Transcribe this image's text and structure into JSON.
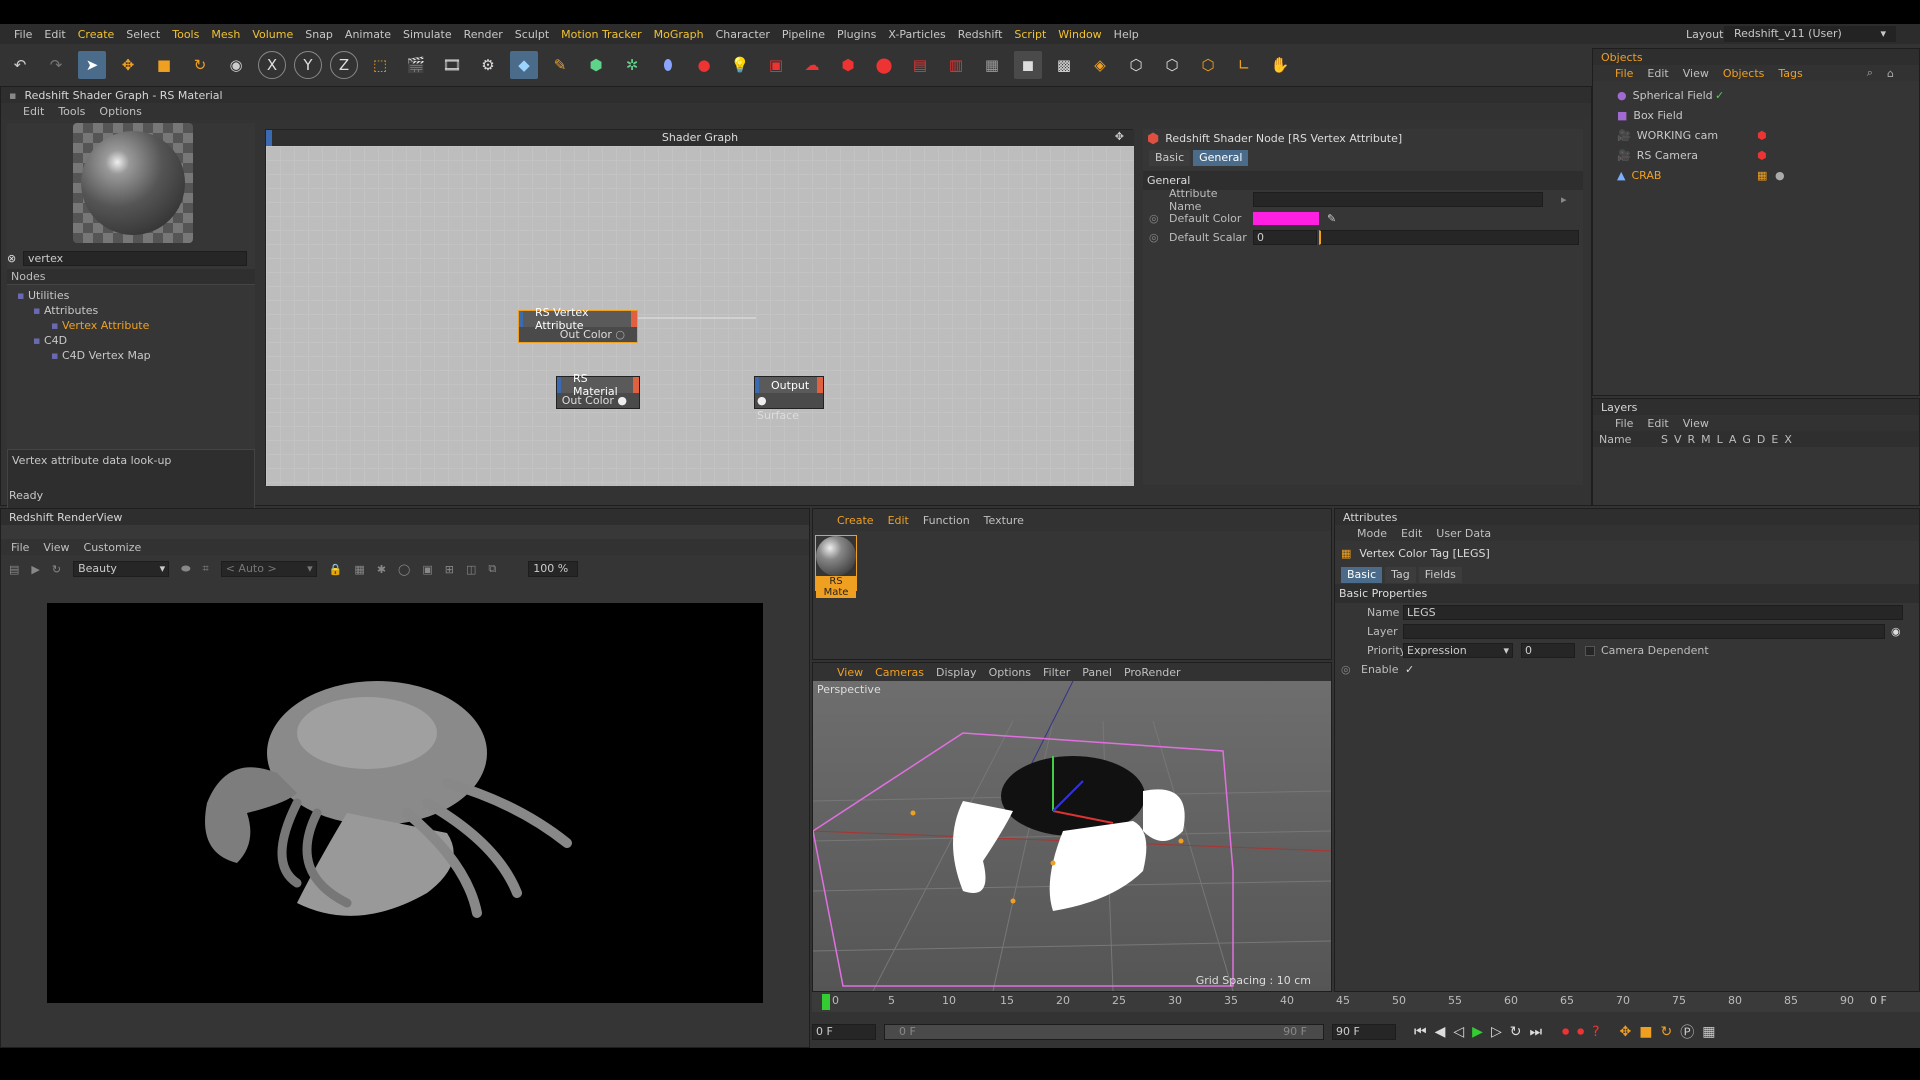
{
  "menubar": {
    "items": [
      "File",
      "Edit",
      "Create",
      "Select",
      "Tools",
      "Mesh",
      "Volume",
      "Snap",
      "Animate",
      "Simulate",
      "Render",
      "Sculpt",
      "Motion Tracker",
      "MoGraph",
      "Character",
      "Pipeline",
      "Plugins",
      "X-Particles",
      "Redshift",
      "Script",
      "Window",
      "Help"
    ],
    "layout_label": "Layout:",
    "layout_value": "Redshift_v11 (User)"
  },
  "shader_window": {
    "title": "Redshift Shader Graph - RS Material",
    "menu": [
      "Edit",
      "Tools",
      "Options"
    ],
    "search_value": "vertex",
    "nodes_header": "Nodes",
    "tree": [
      "Utilities",
      "Attributes",
      "Vertex Attribute",
      "C4D",
      "C4D Vertex Map"
    ],
    "description": "Vertex attribute data look-up",
    "graph_title": "Shader Graph",
    "nodes": {
      "vertex_attr": {
        "title": "RS Vertex Attribute",
        "port": "Out Color"
      },
      "material": {
        "title": "RS Material",
        "port": "Out Color"
      },
      "output": {
        "title": "Output",
        "port": "Surface"
      }
    },
    "props": {
      "title": "Redshift Shader Node [RS Vertex Attribute]",
      "tabs": [
        "Basic",
        "General"
      ],
      "section": "General",
      "attribute_name_label": "Attribute Name",
      "default_color_label": "Default Color",
      "default_color": "#ff1fe0",
      "default_scalar_label": "Default Scalar",
      "default_scalar_value": "0"
    },
    "status": "Ready"
  },
  "objects": {
    "title": "Objects",
    "menu": [
      "File",
      "Edit",
      "View",
      "Objects",
      "Tags"
    ],
    "items": [
      "Spherical Field",
      "Box Field",
      "WORKING cam",
      "RS Camera",
      "CRAB"
    ]
  },
  "layers": {
    "title": "Layers",
    "menu": [
      "File",
      "Edit",
      "View"
    ],
    "col_name": "Name",
    "cols": [
      "S",
      "V",
      "R",
      "M",
      "L",
      "A",
      "G",
      "D",
      "E",
      "X"
    ]
  },
  "renderview": {
    "title": "Redshift RenderView",
    "menu": [
      "File",
      "View",
      "Customize"
    ],
    "aov": "Beauty",
    "camera": "< Auto >",
    "zoom": "100 %"
  },
  "material_manager": {
    "menu": [
      "Create",
      "Edit",
      "Function",
      "Texture"
    ],
    "material_label": "RS Mate"
  },
  "viewport": {
    "menu": [
      "View",
      "Cameras",
      "Display",
      "Options",
      "Filter",
      "Panel",
      "ProRender"
    ],
    "camera_label": "Perspective",
    "grid_spacing": "Grid Spacing : 10 cm"
  },
  "timeline": {
    "ticks": [
      "0",
      "5",
      "10",
      "15",
      "20",
      "25",
      "30",
      "35",
      "40",
      "45",
      "50",
      "55",
      "60",
      "65",
      "70",
      "75",
      "80",
      "85",
      "90"
    ],
    "current_frame": "0 F",
    "start_field": "0 F",
    "range_start": "0 F",
    "range_end": "90 F",
    "end_field": "90 F"
  },
  "attributes": {
    "title": "Attributes",
    "menu": [
      "Mode",
      "Edit",
      "User Data"
    ],
    "object_title": "Vertex Color Tag [LEGS]",
    "tabs": [
      "Basic",
      "Tag",
      "Fields"
    ],
    "section": "Basic Properties",
    "name_label": "Name",
    "name_value": "LEGS",
    "layer_label": "Layer",
    "priority_label": "Priority",
    "priority_value": "Expression",
    "priority_number": "0",
    "camera_dependent_label": "Camera Dependent",
    "enable_label": "Enable",
    "enable_check": "✓"
  }
}
